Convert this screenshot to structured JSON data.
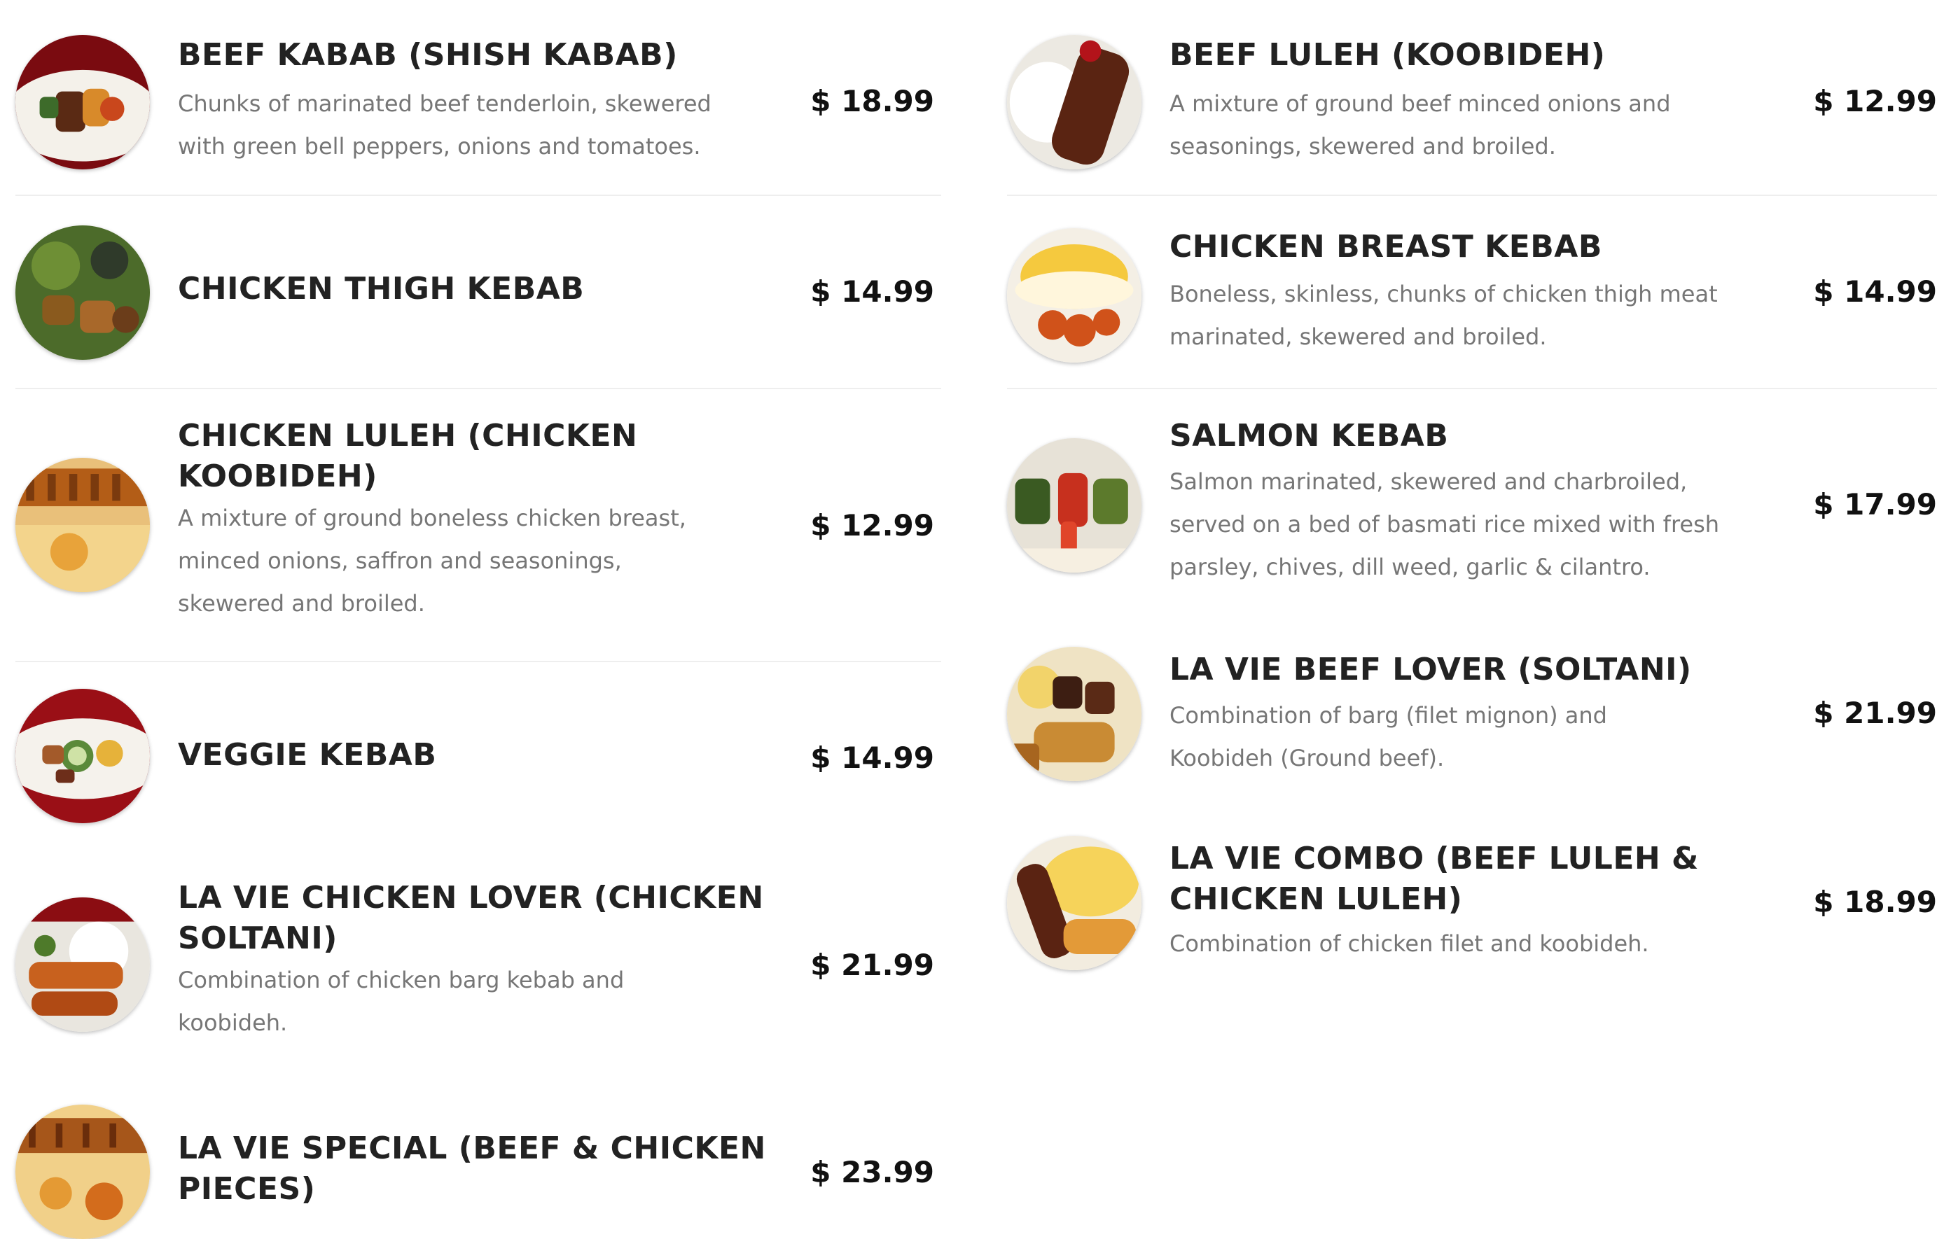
{
  "menu": {
    "left": [
      {
        "name": "BEEF KABAB (SHISH KABAB)",
        "desc_lines": [
          "Chunks of marinated beef tenderloin, skewered",
          "with green bell peppers, onions and tomatoes."
        ],
        "price": "$ 18.99",
        "photo": "beef-kabab-photo"
      },
      {
        "name": "CHICKEN THIGH KEBAB",
        "desc_lines": [],
        "price": "$ 14.99",
        "photo": "chicken-thigh-kebab-photo"
      },
      {
        "name": "CHICKEN LULEH (CHICKEN KOOBIDEH)",
        "desc_lines": [
          "A mixture of ground boneless chicken breast,",
          "minced onions, saffron and seasonings,",
          "skewered and broiled."
        ],
        "price": "$ 12.99",
        "photo": "chicken-luleh-photo"
      },
      {
        "name": "VEGGIE KEBAB",
        "desc_lines": [],
        "price": "$ 14.99",
        "photo": "veggie-kebab-photo"
      },
      {
        "name": "LA VIE CHICKEN LOVER (CHICKEN SOLTANI)",
        "desc_lines": [
          "Combination of chicken barg kebab and",
          "koobideh."
        ],
        "price": "$ 21.99",
        "photo": "chicken-lover-photo"
      },
      {
        "name": "LA VIE SPECIAL (BEEF & CHICKEN PIECES)",
        "desc_lines": [],
        "price": "$ 23.99",
        "photo": "la-vie-special-photo"
      }
    ],
    "right": [
      {
        "name": "BEEF LULEH (KOOBIDEH)",
        "desc_lines": [
          "A mixture of ground beef minced onions and",
          "seasonings, skewered and broiled."
        ],
        "price": "$ 12.99",
        "photo": "beef-luleh-photo"
      },
      {
        "name": "CHICKEN BREAST KEBAB",
        "desc_lines": [
          "Boneless, skinless, chunks of chicken thigh meat",
          "marinated, skewered and broiled."
        ],
        "price": "$ 14.99",
        "photo": "chicken-breast-kebab-photo"
      },
      {
        "name": "SALMON KEBAB",
        "desc_lines": [
          "Salmon marinated, skewered and charbroiled,",
          "served on a bed of basmati rice mixed with fresh",
          "parsley, chives, dill weed, garlic & cilantro."
        ],
        "price": "$ 17.99",
        "photo": "salmon-kebab-photo"
      },
      {
        "name": "LA VIE BEEF LOVER (SOLTANI)",
        "desc_lines": [
          "Combination of barg (filet mignon) and",
          "Koobideh (Ground beef)."
        ],
        "price": "$ 21.99",
        "photo": "beef-lover-photo"
      },
      {
        "name": "LA VIE COMBO (BEEF LULEH & CHICKEN LULEH)",
        "desc_lines": [
          "Combination of chicken filet and koobideh."
        ],
        "price": "$ 18.99",
        "photo": "la-vie-combo-photo"
      }
    ]
  },
  "colors": {
    "title": "#222222",
    "description": "#767676",
    "price": "#111111",
    "separator": "#eeeeee",
    "plate_red": "#8b0d12"
  }
}
